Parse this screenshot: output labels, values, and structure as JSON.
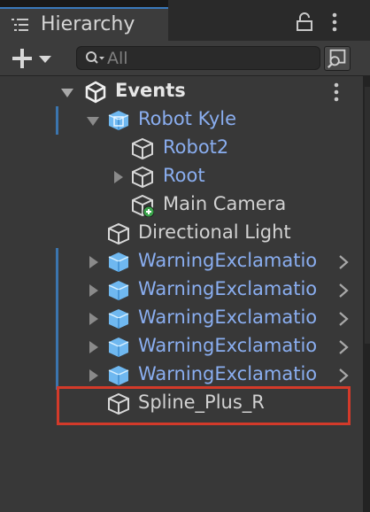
{
  "window": {
    "tab_title": "Hierarchy",
    "tab_icon": "list-icon",
    "lock_icon": "lock-icon",
    "menu_icon": "kebab-menu-icon"
  },
  "toolbar": {
    "add_icon": "plus-dropdown-icon",
    "search_placeholder": "All",
    "search_icon": "search-dropdown-icon",
    "scene_search_icon": "scene-search-icon"
  },
  "tree": {
    "scene": {
      "label": "Events",
      "icon": "unity-logo-icon"
    },
    "items": [
      {
        "label": "Robot Kyle",
        "type": "prefab",
        "expanded": true
      },
      {
        "label": "Robot2",
        "type": "prefab-child"
      },
      {
        "label": "Root",
        "type": "prefab-child",
        "collapsed": true
      },
      {
        "label": "Main Camera",
        "type": "added-object"
      },
      {
        "label": "Directional Light",
        "type": "gameobject"
      },
      {
        "label": "WarningExclamatio",
        "type": "prefab"
      },
      {
        "label": "WarningExclamatio",
        "type": "prefab"
      },
      {
        "label": "WarningExclamatio",
        "type": "prefab"
      },
      {
        "label": "WarningExclamatio",
        "type": "prefab"
      },
      {
        "label": "WarningExclamatio",
        "type": "prefab"
      },
      {
        "label": "Spline_Plus_R",
        "type": "gameobject",
        "highlighted": true
      }
    ]
  },
  "colors": {
    "prefab_text": "#8aaef0",
    "plain_text": "#d2d2d2",
    "highlight_border": "#d33a2a",
    "override_marker": "#3b75ae"
  }
}
